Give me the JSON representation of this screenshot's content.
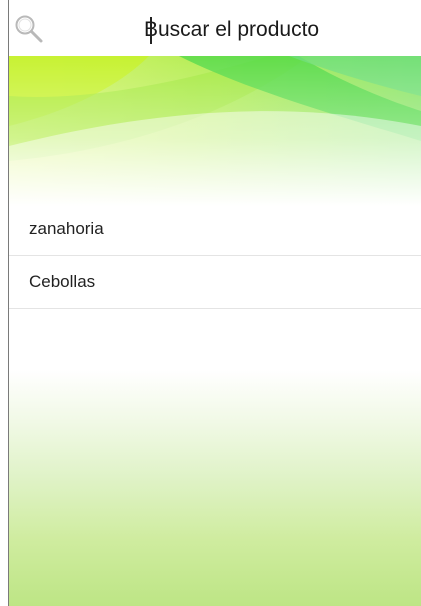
{
  "search": {
    "placeholder": "Buscar el producto",
    "value": ""
  },
  "results": {
    "items": [
      {
        "label": "zanahoria"
      },
      {
        "label": "Cebollas"
      }
    ]
  },
  "icons": {
    "search": "search-icon"
  },
  "colors": {
    "accent_green": "#7ed957",
    "lime": "#c8f23a",
    "bottom_green": "#bde585"
  }
}
